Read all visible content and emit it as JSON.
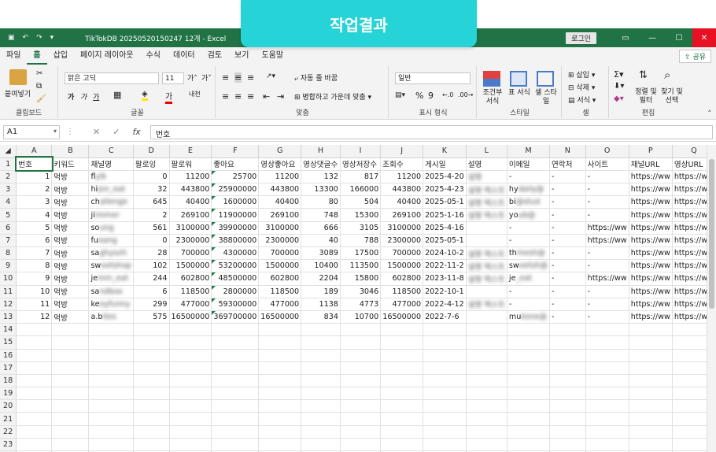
{
  "banner": {
    "title": "작업결과"
  },
  "window": {
    "title": "TikTokDB 20250520150247 12개  -  Excel",
    "login": "로그인"
  },
  "menu": [
    "파일",
    "홈",
    "삽입",
    "페이지 레이아웃",
    "수식",
    "데이터",
    "검토",
    "보기",
    "도움말"
  ],
  "share": "공유",
  "ribbon": {
    "clipboard": {
      "label": "클립보드",
      "paste": "붙여넣기"
    },
    "font": {
      "label": "글꼴",
      "name": "맑은 고딕",
      "size": "11",
      "bold": "가",
      "italic": "가",
      "underline": "가"
    },
    "align": {
      "label": "맞춤",
      "wrap": "자동 줄 바꿈",
      "merge": "병합하고 가운데 맞춤"
    },
    "number": {
      "label": "표시 형식",
      "format": "일반"
    },
    "style": {
      "label": "스타일",
      "cond": "조건부 서식",
      "table": "표 서식",
      "cell": "셀 스타일"
    },
    "cells": {
      "label": "셀",
      "insert": "삽입",
      "delete": "삭제",
      "format": "서식"
    },
    "edit": {
      "label": "편집",
      "sort": "정렬 및 필터",
      "find": "찾기 및 선택"
    }
  },
  "formula": {
    "cell": "A1",
    "value": "번호"
  },
  "columns": [
    "A",
    "B",
    "C",
    "D",
    "E",
    "F",
    "G",
    "H",
    "I",
    "J",
    "K",
    "L",
    "M",
    "N",
    "O",
    "P",
    "Q"
  ],
  "headers": [
    "번호",
    "키워드",
    "채널명",
    "팔로잉",
    "팔로워",
    "좋아요",
    "영상좋아요",
    "영상댓글수",
    "영상저장수",
    "조회수",
    "게시일",
    "설명",
    "이메일",
    "연락처",
    "사이트",
    "채널URL",
    "영상URL"
  ],
  "rows": [
    [
      "1",
      "먹방",
      "fl",
      "0",
      "11200",
      "25700",
      "11200",
      "132",
      "817",
      "11200",
      "2025-4-20",
      "",
      "-",
      "-",
      "-",
      "https://ww",
      "https://ww"
    ],
    [
      "2",
      "먹방",
      "hi",
      "32",
      "443800",
      "25900000",
      "443800",
      "13300",
      "166000",
      "443800",
      "2025-4-23",
      "",
      "hy",
      "-",
      "-",
      "https://ww",
      "https://ww"
    ],
    [
      "3",
      "먹방",
      "ch",
      "645",
      "40400",
      "1600000",
      "40400",
      "80",
      "504",
      "40400",
      "2025-05-1",
      "",
      "bi",
      "-",
      "-",
      "https://ww",
      "https://ww"
    ],
    [
      "4",
      "먹방",
      "ji",
      "2",
      "269100",
      "11900000",
      "269100",
      "748",
      "15300",
      "269100",
      "2025-1-16",
      "",
      "yo",
      "-",
      "-",
      "https://ww",
      "https://ww"
    ],
    [
      "5",
      "먹방",
      "so",
      "561",
      "3100000",
      "39900000",
      "3100000",
      "666",
      "3105",
      "3100000",
      "2025-4-16",
      "",
      "-",
      "-",
      "https://ww",
      "https://ww",
      "https://ww"
    ],
    [
      "6",
      "먹방",
      "fu",
      "0",
      "2300000",
      "38800000",
      "2300000",
      "40",
      "788",
      "2300000",
      "2025-05-1",
      "",
      "-",
      "-",
      "https://ww",
      "https://ww",
      "https://ww"
    ],
    [
      "7",
      "먹방",
      "sa",
      "28",
      "700000",
      "4300000",
      "700000",
      "3089",
      "17500",
      "700000",
      "2024-10-2",
      "",
      "th",
      "-",
      "-",
      "https://ww",
      "https://ww"
    ],
    [
      "8",
      "먹방",
      "sw",
      "102",
      "1500000",
      "53200000",
      "1500000",
      "10400",
      "113500",
      "1500000",
      "2022-11-2",
      "",
      "sw",
      "-",
      "-",
      "https://ww",
      "https://ww"
    ],
    [
      "9",
      "먹방",
      "je",
      "244",
      "602800",
      "48500000",
      "602800",
      "2204",
      "15800",
      "602800",
      "2023-11-8",
      "",
      "je",
      "-",
      "https://ww",
      "https://ww",
      "https://ww"
    ],
    [
      "10",
      "먹방",
      "sa",
      "6",
      "118500",
      "2800000",
      "118500",
      "189",
      "3046",
      "118500",
      "2022-10-1",
      "",
      "-",
      "-",
      "-",
      "https://ww",
      "https://ww"
    ],
    [
      "11",
      "먹방",
      "ke",
      "299",
      "477000",
      "59300000",
      "477000",
      "1138",
      "4773",
      "477000",
      "2022-4-12",
      "",
      "-",
      "-",
      "-",
      "https://ww",
      "https://ww"
    ],
    [
      "12",
      "먹방",
      "a.b",
      "575",
      "16500000",
      "369700000",
      "16500000",
      "834",
      "10700",
      "16500000",
      "2022-7-6",
      "",
      "mu",
      "-",
      "-",
      "https://ww",
      "https://ww"
    ]
  ],
  "blurred": {
    "channel": [
      "ylk",
      "jon_eat",
      "allenge",
      "immer",
      "ung",
      "eang",
      "ghysoh",
      "eetshop",
      "mm_eat",
      "ndbox",
      "eyfunny",
      "ites"
    ],
    "desc": [
      "설명",
      "설명 텍스트",
      "설명 텍스트",
      "설명 텍스트",
      "",
      "",
      "설명 텍스트",
      "설명 텍스트",
      "설명 텍스트",
      "",
      "설명 텍스트",
      ""
    ],
    "email": [
      "",
      "daily@",
      "@stud",
      "ub@",
      "",
      "",
      "mesh@",
      "eetsh@",
      "_eat",
      "",
      "",
      "kone@"
    ]
  },
  "row_count": 24
}
